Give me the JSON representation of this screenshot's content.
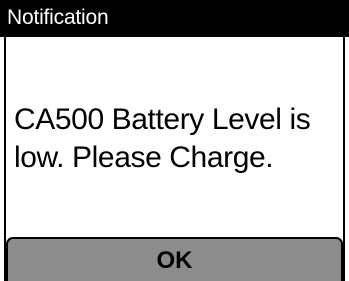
{
  "dialog": {
    "title": "Notification",
    "message_line1": "CA500 Battery Level is",
    "message_line2": "low. Please Charge.",
    "ok_label": "OK"
  },
  "colors": {
    "title_bar": "#000000",
    "title_text": "#ffffff",
    "background": "#ffffff",
    "button": "#8c8c8c",
    "text": "#000000"
  }
}
